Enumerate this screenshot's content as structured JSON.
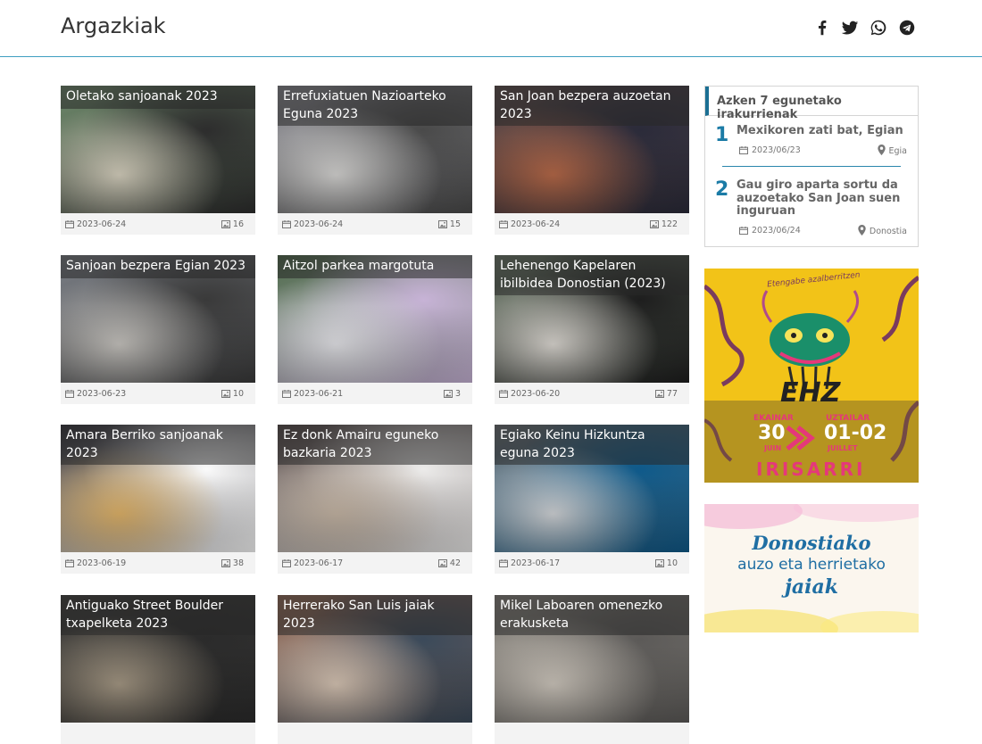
{
  "header": {
    "title": "Argazkiak",
    "social": [
      "facebook-icon",
      "twitter-icon",
      "whatsapp-icon",
      "telegram-icon"
    ]
  },
  "gallery": [
    {
      "title": "Oletako sanjoanak 2023",
      "date": "2023-06-24",
      "count": "16"
    },
    {
      "title": "Errefuxiatuen Nazioarteko Eguna 2023",
      "date": "2023-06-24",
      "count": "15"
    },
    {
      "title": "San Joan bezpera auzoetan 2023",
      "date": "2023-06-24",
      "count": "122"
    },
    {
      "title": "Sanjoan bezpera Egian 2023",
      "date": "2023-06-23",
      "count": "10"
    },
    {
      "title": "Aitzol parkea margotuta",
      "date": "2023-06-21",
      "count": "3"
    },
    {
      "title": "Lehenengo Kapelaren ibilbidea Donostian (2023)",
      "date": "2023-06-20",
      "count": "77"
    },
    {
      "title": "Amara Berriko sanjoanak 2023",
      "date": "2023-06-19",
      "count": "38"
    },
    {
      "title": "Ez donk Amairu eguneko bazkaria 2023",
      "date": "2023-06-17",
      "count": "42"
    },
    {
      "title": "Egiako Keinu Hizkuntza eguna 2023",
      "date": "2023-06-17",
      "count": "10"
    },
    {
      "title": "Antiguako Street Boulder txapelketa 2023",
      "date": "",
      "count": ""
    },
    {
      "title": "Herrerako San Luis jaiak 2023",
      "date": "",
      "count": ""
    },
    {
      "title": "Mikel Laboaren omenezko erakusketa",
      "date": "",
      "count": ""
    }
  ],
  "most_read": {
    "heading": "Azken 7 egunetako irakurrienak",
    "items": [
      {
        "rank": "1",
        "title": "Mexikoren zati bat, Egian",
        "date": "2023/06/23",
        "place": "Egia"
      },
      {
        "rank": "2",
        "title": "Gau giro aparta sortu da auzoetako San Joan suen inguruan",
        "date": "2023/06/24",
        "place": "Donostia"
      }
    ]
  },
  "ads": {
    "ad1": {
      "top_text": "Etengabe azalberritzen",
      "logo": "EHZ",
      "month_left": "EKAINAR",
      "day_left": "30",
      "month_left_fr": "JUIN",
      "month_right": "UZTAILAR",
      "day_right": "01-02",
      "month_right_fr": "JUILLET",
      "place": "IRISARRI"
    },
    "ad2": {
      "line1": "Donostiako",
      "line2": "auzo eta herrietako",
      "line3": "jaiak"
    }
  },
  "colors": {
    "accent": "#1b7ba6",
    "header_line": "#3f9ec0",
    "ad1_bg": "#f2c318",
    "ad2_text": "#1f6ea3"
  }
}
